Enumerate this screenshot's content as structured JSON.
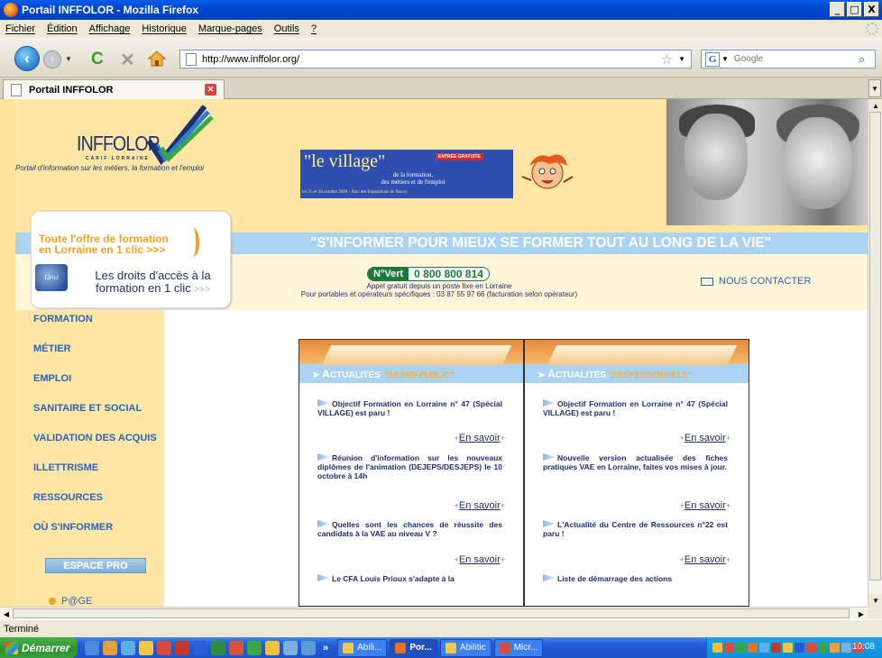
{
  "window": {
    "title": "Portail INFFOLOR - Mozilla Firefox",
    "buttons": [
      "_",
      "□",
      "X"
    ]
  },
  "menu": [
    "Fichier",
    "Édition",
    "Affichage",
    "Historique",
    "Marque-pages",
    "Outils",
    "?"
  ],
  "toolbar": {
    "url": "http://www.inffolor.org/",
    "search_placeholder": "Google"
  },
  "tab": {
    "label": "Portail INFFOLOR"
  },
  "site": {
    "logo_word": "INFFOLOR",
    "logo_sub": "CARIF LORRAINE",
    "tagline": "Portail d'information sur les métiers, la formation et l'emploi",
    "banner": {
      "title": "\"le village\"",
      "free": "ENTRÉE GRATUITE",
      "line1": "de la formation,",
      "line2": "des métiers et de l'emploi",
      "dates": "les 25 et 26 octobre 2008 - Parc des Expositions de Nancy"
    },
    "offre": {
      "line1": "Toute l'offre de formation",
      "line2": "en Lorraine en 1 clic >>>",
      "badge": "Liriel",
      "droits1": "Les droits d'accès à la",
      "droits2": "formation en 1 clic",
      "arrows": ">>>"
    },
    "slogan": "\"S'INFORMER POUR MIEUX SE FORMER TOUT AU LONG DE LA VIE\"",
    "numero_vert_label": "N°Vert",
    "numero_vert": "0 800 800 814",
    "appel1": "Appel gratuit depuis un poste fixe en Lorraine",
    "appel2": "Pour portables et opérateurs spécifiques : 03 87 55 97 66 (facturation selon opérateur)",
    "contact": "NOUS CONTACTER"
  },
  "sidebar": {
    "items": [
      "FORMATION",
      "MÉTIER",
      "EMPLOI",
      "SANITAIRE ET SOCIAL",
      "VALIDATION DES ACQUIS",
      "ILLETTRISME",
      "RESSOURCES",
      "OÙ S'INFORMER"
    ],
    "espace_pro": "ESPACE PRO",
    "page_link": "P@GE"
  },
  "news": {
    "grand_public": {
      "title_big": "A",
      "title_rest": "CTUALITÉS",
      "subtitle": "\"GRAND-PUBLIC\"",
      "items": [
        "Objectif Formation en Lorraine n° 47 (Spécial VILLAGE) est paru !",
        "Réunion d'information sur les nouveaux diplômes de l'animation (DEJEPS/DESJEPS) le 10 octobre à 14h",
        "Quelles sont les chances de réussite des candidats à la VAE au niveau V ?",
        "Le CFA Louis Prioux s'adapte à la"
      ]
    },
    "professionnels": {
      "title_big": "A",
      "title_rest": "CTUALITÉS",
      "subtitle": "\"PROFESSIONNELS\"",
      "items": [
        "Objectif Formation en Lorraine n° 47 (Spécial VILLAGE) est paru !",
        "Nouvelle version actualisée des fiches pratiques VAE en Lorraine, faites vos mises à jour.",
        "L'Actualité du Centre de Ressources n°22 est paru !",
        "Liste de démarrage des actions"
      ]
    },
    "more_label": "En savoir",
    "plus": "+"
  },
  "status": "Terminé",
  "taskbar": {
    "start": "Démarrer",
    "overflow": "»",
    "tasks": [
      "Abili...",
      "Por...",
      "Abilitic",
      "Micr..."
    ],
    "clock": "10:08"
  },
  "colors": {
    "page_bg": "#ffe6a4",
    "link_blue": "#2a64b6",
    "orange": "#f2a11e",
    "vert": "#1c7a3d",
    "slogan_bg": "#a9d3f0"
  }
}
